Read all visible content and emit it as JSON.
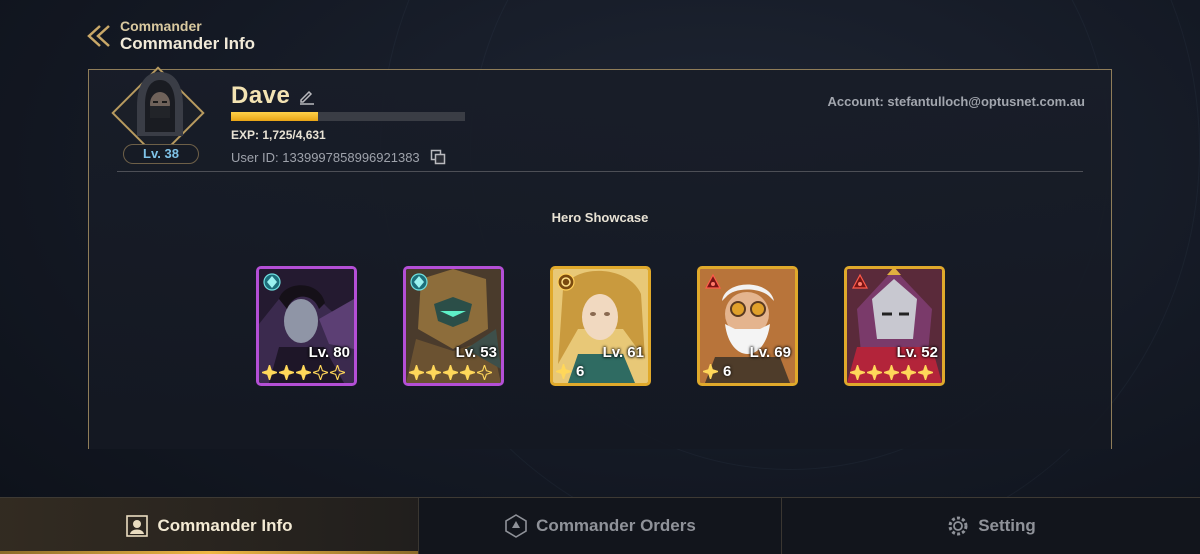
{
  "header": {
    "section": "Commander",
    "title": "Commander Info"
  },
  "profile": {
    "name": "Dave",
    "level_label": "Lv. 38",
    "exp_text": "EXP: 1,725/4,631",
    "exp_current": 1725,
    "exp_max": 4631,
    "user_id": "User ID: 1339997858996921383",
    "account": "Account: stefantulloch@optusnet.com.au"
  },
  "showcase": {
    "title": "Hero Showcase",
    "heroes": [
      {
        "level": "Lv. 80",
        "frame": "purple",
        "faction_icon": "crystal-faction-icon",
        "stars": 5,
        "filled_stars": 3,
        "star_count": ""
      },
      {
        "level": "Lv. 53",
        "frame": "purple",
        "faction_icon": "crystal-faction-icon",
        "stars": 5,
        "filled_stars": 4,
        "star_count": ""
      },
      {
        "level": "Lv. 61",
        "frame": "gold",
        "faction_icon": "sun-faction-icon",
        "stars": 1,
        "filled_stars": 1,
        "star_count": "6"
      },
      {
        "level": "Lv. 69",
        "frame": "gold",
        "faction_icon": "flame-faction-icon",
        "stars": 1,
        "filled_stars": 1,
        "star_count": "6"
      },
      {
        "level": "Lv. 52",
        "frame": "gold",
        "faction_icon": "flame-faction-icon",
        "stars": 5,
        "filled_stars": 5,
        "star_count": ""
      }
    ]
  },
  "nav": {
    "tabs": [
      {
        "label": "Commander Info",
        "icon": "commander-info-icon",
        "active": true
      },
      {
        "label": "Commander Orders",
        "icon": "orders-icon",
        "active": false
      },
      {
        "label": "Setting",
        "icon": "gear-icon",
        "active": false
      }
    ]
  },
  "colors": {
    "accent_gold": "#e0a92b",
    "frame_purple": "#b44fd6",
    "exp_fill": "#ffc62e",
    "level_blue": "#7fc3e8"
  }
}
